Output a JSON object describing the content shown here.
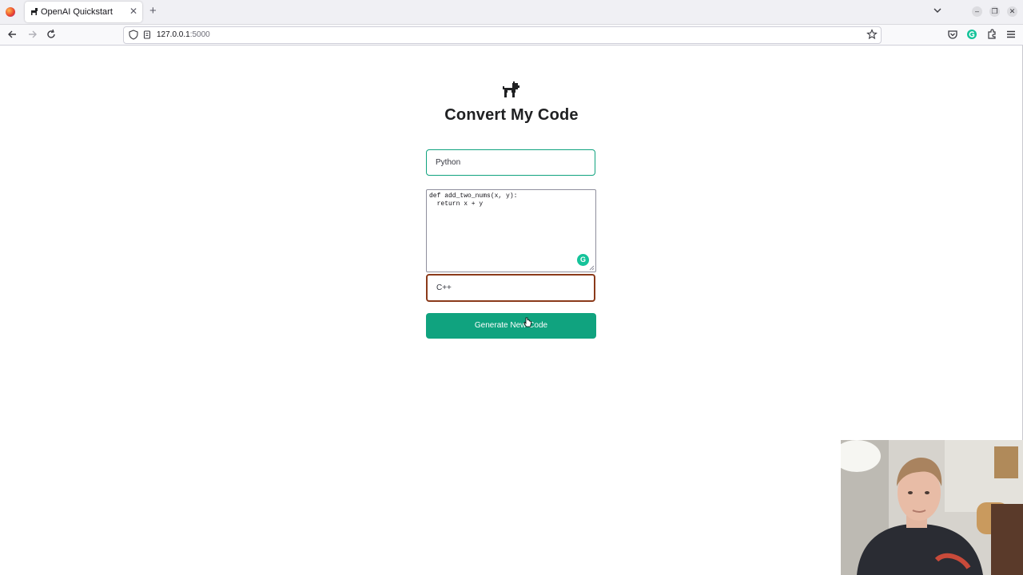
{
  "browser": {
    "tab_title": "OpenAI Quickstart",
    "url_host": "127.0.0.1",
    "url_port": ":5000"
  },
  "page": {
    "title": "Convert My Code",
    "source_language": "Python",
    "code_lines": "def add_two_nums(x, y):\n  return x + y",
    "target_language": "C++",
    "button_label": "Generate New Code"
  },
  "icons": {
    "logo": "dog-icon",
    "grammarly": "grammarly-icon"
  },
  "colors": {
    "accent": "#10a37f",
    "focus_border": "#8b3a1a",
    "title": "#202123"
  }
}
